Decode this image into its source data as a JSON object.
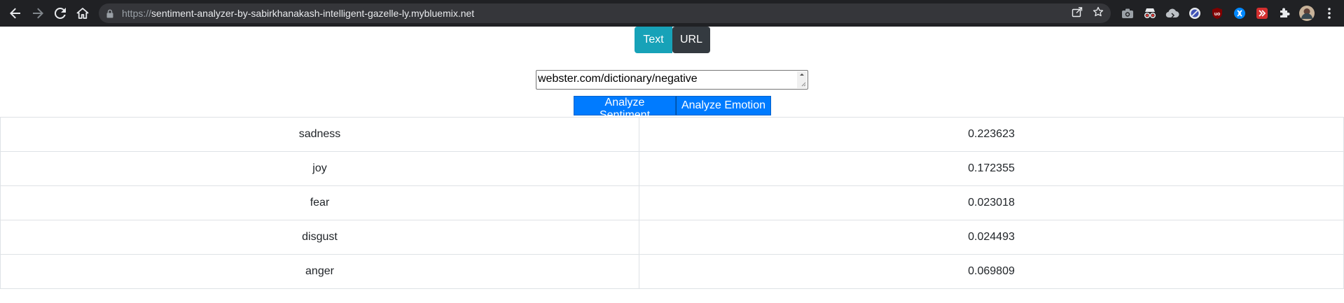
{
  "browser": {
    "url_scheme": "https://",
    "url_host": "sentiment-analyzer-by-sabirkhanakash-intelligent-gazelle-ly.mybluemix.net",
    "icons": [
      "back-arrow-icon",
      "forward-arrow-icon",
      "reload-icon",
      "home-icon",
      "lock-icon",
      "share-icon",
      "bookmark-star-icon",
      "camera-extension-icon",
      "spy-extension-icon",
      "cloud-extension-icon",
      "block-extension-icon",
      "ublock-extension-icon",
      "shazam-extension-icon",
      "redirect-extension-icon",
      "puzzle-icon",
      "profile-avatar",
      "menu-dots-icon"
    ],
    "extension_labels": {
      "ublock": "uo"
    }
  },
  "mode_toggle": {
    "text_label": "Text",
    "url_label": "URL",
    "active": "Text",
    "active_color": "#17a2b8",
    "inactive_color": "#343a40"
  },
  "input": {
    "value": "webster.com/dictionary/negative"
  },
  "actions": {
    "sentiment_label": "Analyze Sentiment",
    "emotion_label": "Analyze Emotion",
    "button_color": "#007bff"
  },
  "results": {
    "rows": [
      {
        "emotion": "sadness",
        "score": "0.223623"
      },
      {
        "emotion": "joy",
        "score": "0.172355"
      },
      {
        "emotion": "fear",
        "score": "0.023018"
      },
      {
        "emotion": "disgust",
        "score": "0.024493"
      },
      {
        "emotion": "anger",
        "score": "0.069809"
      }
    ]
  }
}
